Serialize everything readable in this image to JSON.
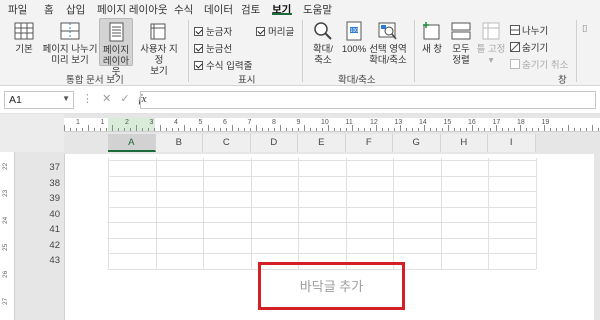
{
  "menu": {
    "tabs": [
      {
        "label": "파일",
        "active": false
      },
      {
        "label": "홈",
        "active": false
      },
      {
        "label": "삽입",
        "active": false
      },
      {
        "label": "페이지 레이아웃",
        "active": false
      },
      {
        "label": "수식",
        "active": false
      },
      {
        "label": "데이터",
        "active": false
      },
      {
        "label": "검토",
        "active": false
      },
      {
        "label": "보기",
        "active": true
      },
      {
        "label": "도움말",
        "active": false
      }
    ]
  },
  "ribbon": {
    "workbook_views": {
      "group_label": "통합 문서 보기",
      "normal": "기본",
      "page_break_l1": "페이지 나누기",
      "page_break_l2": "미리 보기",
      "page_layout_l1": "페이지",
      "page_layout_l2": "레이아웃",
      "custom_l1": "사용자 지정",
      "custom_l2": "보기"
    },
    "show": {
      "group_label": "표시",
      "ruler": "눈금자",
      "headings": "머리글",
      "gridlines": "눈금선",
      "formula_bar": "수식 입력줄"
    },
    "zoom": {
      "group_label": "확대/축소",
      "zoom_l1": "확대/",
      "zoom_l2": "축소",
      "zoom100": "100%",
      "zoom_sel_l1": "선택 영역",
      "zoom_sel_l2": "확대/축소"
    },
    "window": {
      "group_label": "창",
      "new_window": "새 창",
      "arrange_l1": "모두",
      "arrange_l2": "정렬",
      "freeze": "틀 고정",
      "split": "나누기",
      "hide": "숨기기",
      "unhide": "숨기기 취소"
    }
  },
  "formula_bar": {
    "name_box": "A1",
    "fx_label": "fx",
    "formula": ""
  },
  "sheet": {
    "columns": [
      "A",
      "B",
      "C",
      "D",
      "E",
      "F",
      "G",
      "H",
      "I"
    ],
    "rows": [
      "37",
      "38",
      "39",
      "40",
      "41",
      "42",
      "43"
    ],
    "ruler_numbers": [
      "1",
      "1",
      "2",
      "3",
      "4",
      "5",
      "6",
      "7",
      "8",
      "9",
      "10",
      "11",
      "12",
      "13",
      "14",
      "15",
      "16",
      "17",
      "18",
      "19"
    ],
    "vruler_numbers": [
      "22",
      "23",
      "24",
      "25",
      "26",
      "27"
    ],
    "footer_placeholder": "바닥글 추가"
  },
  "colors": {
    "accent": "#1d6a3a",
    "highlight_border": "#d31f26"
  }
}
